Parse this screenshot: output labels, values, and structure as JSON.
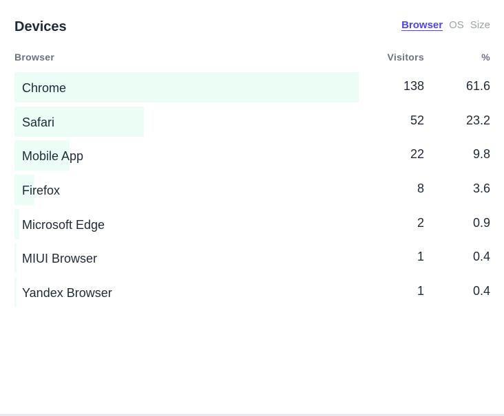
{
  "card": {
    "title": "Devices",
    "tabs": [
      {
        "label": "Browser",
        "active": true
      },
      {
        "label": "OS",
        "active": false
      },
      {
        "label": "Size",
        "active": false
      }
    ],
    "columns": {
      "name": "Browser",
      "visitors": "Visitors",
      "percent": "%"
    },
    "rows": [
      {
        "name": "Chrome",
        "visitors": "138",
        "percent": "61.6",
        "share": 61.6
      },
      {
        "name": "Safari",
        "visitors": "52",
        "percent": "23.2",
        "share": 23.2
      },
      {
        "name": "Mobile App",
        "visitors": "22",
        "percent": "9.8",
        "share": 9.8
      },
      {
        "name": "Firefox",
        "visitors": "8",
        "percent": "3.6",
        "share": 3.6
      },
      {
        "name": "Microsoft Edge",
        "visitors": "2",
        "percent": "0.9",
        "share": 0.9
      },
      {
        "name": "MIUI Browser",
        "visitors": "1",
        "percent": "0.4",
        "share": 0.4
      },
      {
        "name": "Yandex Browser",
        "visitors": "1",
        "percent": "0.4",
        "share": 0.4
      }
    ]
  },
  "colors": {
    "accent": "#4f46e5",
    "bar": "#ecfdf5",
    "muted": "#9ca3af"
  }
}
